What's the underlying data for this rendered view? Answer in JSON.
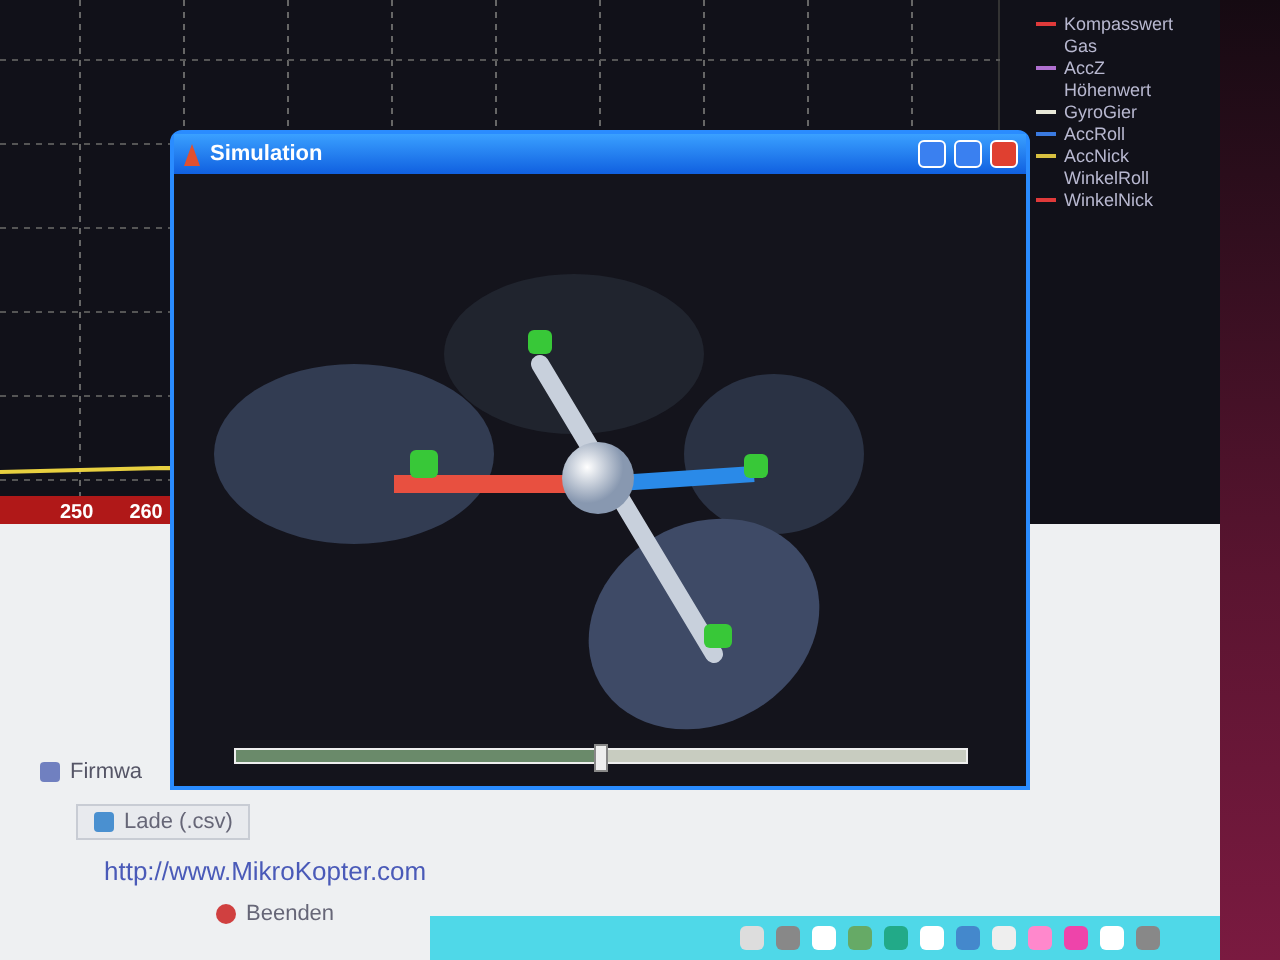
{
  "graph": {
    "x_labels": [
      "250",
      "260"
    ]
  },
  "legend": [
    {
      "label": "Kompasswert",
      "color": "#e03a3a"
    },
    {
      "label": "Gas"
    },
    {
      "label": "AccZ",
      "color": "#b070d0"
    },
    {
      "label": "Höhenwert"
    },
    {
      "label": "GyroGier",
      "color": "#e8e8d8"
    },
    {
      "label": "AccRoll",
      "color": "#3a7ae0"
    },
    {
      "label": "AccNick",
      "color": "#d8c040"
    },
    {
      "label": "WinkelRoll"
    },
    {
      "label": "WinkelNick",
      "color": "#e03a3a"
    }
  ],
  "simulation_window": {
    "title": "Simulation",
    "slider": {
      "level": 0.5
    }
  },
  "panel": {
    "firmware_label": "Firmwa",
    "load_button": "Lade (.csv)",
    "link": "http://www.MikroKopter.com",
    "quit_button": "Beenden"
  }
}
